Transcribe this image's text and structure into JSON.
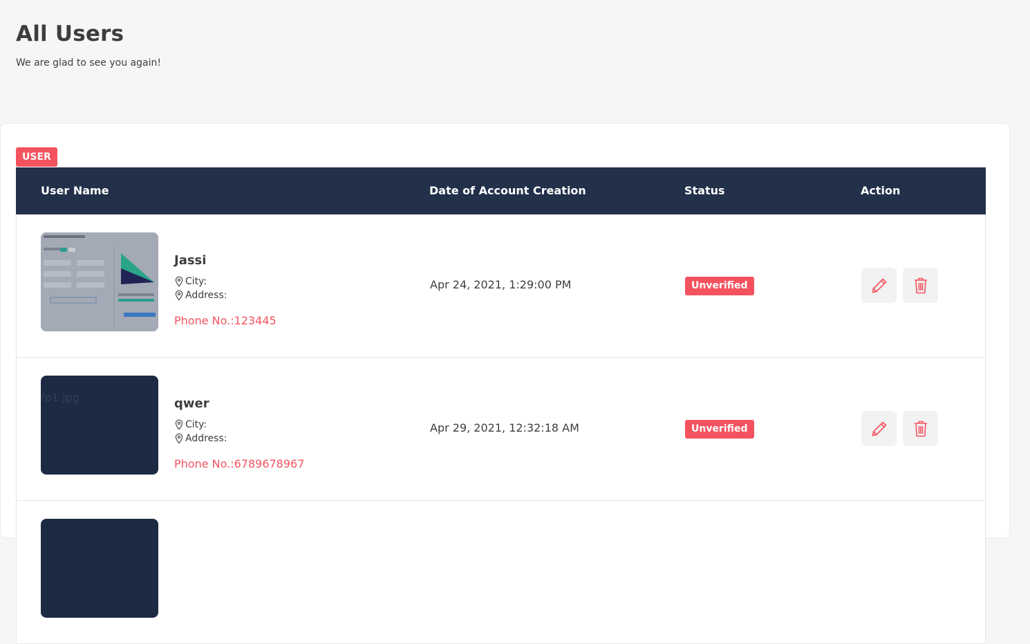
{
  "header": {
    "title": "All Users",
    "subtitle": "We are glad to see you again!"
  },
  "role_badge": "USER",
  "table": {
    "columns": [
      "User Name",
      "Date of Account Creation",
      "Status",
      "Action"
    ],
    "rows": [
      {
        "name": "Jassi",
        "city_label": "City:",
        "address_label": "Address:",
        "phone": "Phone No.:123445",
        "created": "Apr 24, 2021, 1:29:00 PM",
        "status": "Unverified",
        "thumb_alt": ""
      },
      {
        "name": "qwer",
        "city_label": "City:",
        "address_label": "Address:",
        "phone": "Phone No.:6789678967",
        "created": "Apr 29, 2021, 12:32:18 AM",
        "status": "Unverified",
        "thumb_alt": "fp1.jpg"
      }
    ]
  },
  "colors": {
    "accent": "#f4525f",
    "table_header": "#22304a",
    "thumb_dark": "#1d2a43"
  },
  "icons": {
    "location": "map-pin-icon",
    "edit": "pencil-icon",
    "delete": "trash-icon"
  }
}
